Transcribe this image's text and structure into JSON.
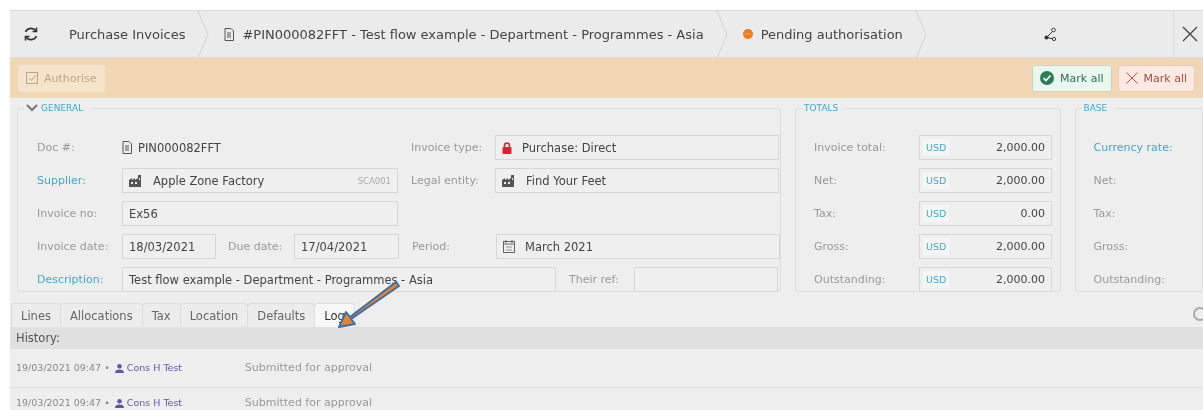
{
  "header": {
    "breadcrumbs": [
      {
        "label": "Purchase Invoices"
      },
      {
        "label": "#PIN000082FFT - Test flow example - Department - Programmes - Asia"
      },
      {
        "label": "Pending authorisation"
      }
    ]
  },
  "toolbar": {
    "left_buttons": [
      {
        "label": "Authorise",
        "kind": "check",
        "disabled": true
      }
    ],
    "right_buttons": [
      {
        "label": "Mark all",
        "kind": "approve"
      },
      {
        "label": "Mark all",
        "kind": "reject"
      }
    ]
  },
  "general": {
    "title": "GENERAL",
    "expanded": true,
    "rows": [
      [
        {
          "label": "Doc #:",
          "value": "PIN000082FFT",
          "kind": "plain"
        },
        {
          "label": "Invoice type:",
          "value": "Purchase: Direct",
          "kind": "box"
        }
      ],
      [
        {
          "label": "Supplier:",
          "link": true,
          "value": "Apple Zone Factory",
          "code": "SCA001",
          "kind": "box"
        },
        {
          "label": "Legal entity:",
          "value": "Find Your Feet",
          "kind": "box"
        }
      ],
      [
        {
          "label": "Invoice no:",
          "value": "Ex56",
          "kind": "box"
        }
      ],
      [
        {
          "label": "Invoice date:",
          "value": "18/03/2021",
          "kind": "box"
        },
        {
          "label": "Due date:",
          "value": "17/04/2021",
          "kind": "box"
        },
        {
          "label": "Period:",
          "value": "March 2021",
          "kind": "box"
        }
      ],
      [
        {
          "label": "Description:",
          "link": true,
          "value": "Test flow example - Department - Programmes - Asia",
          "kind": "box"
        },
        {
          "label": "Their ref:",
          "kind": "box"
        }
      ]
    ]
  },
  "totals": {
    "title": "TOTALS",
    "rows": [
      {
        "label": "Invoice total:",
        "currency": "USD",
        "amount": "2,000.00"
      },
      {
        "label": "Net:",
        "currency": "USD",
        "amount": "2,000.00"
      },
      {
        "label": "Tax:",
        "currency": "USD",
        "amount": "0.00"
      },
      {
        "label": "Gross:",
        "currency": "USD",
        "amount": "2,000.00"
      },
      {
        "label": "Outstanding:",
        "currency": "USD",
        "amount": "2,000.00"
      }
    ]
  },
  "base": {
    "title": "BASE",
    "rows": [
      {
        "label": "Currency rate:",
        "link": true
      },
      {
        "label": "Net:",
        "link": false
      },
      {
        "label": "Tax:",
        "link": false
      },
      {
        "label": "Gross:",
        "link": false
      },
      {
        "label": "Outstanding:",
        "link": false
      }
    ]
  },
  "tabs": [
    {
      "label": "Lines",
      "selected": false
    },
    {
      "label": "Allocations",
      "selected": false
    },
    {
      "label": "Tax",
      "selected": false
    },
    {
      "label": "Location",
      "selected": false
    },
    {
      "label": "Defaults",
      "selected": false
    },
    {
      "label": "Log",
      "selected": true
    }
  ],
  "history": {
    "title": "History:",
    "entries": [
      {
        "time": "19/03/2021 09:47 •",
        "user": "Cons H Test",
        "message": "Submitted for approval"
      },
      {
        "time": "19/03/2021 09:47 •",
        "user": "Cons H Test",
        "message": "Submitted for approval"
      }
    ]
  },
  "annotation": {
    "kind": "arrow"
  }
}
